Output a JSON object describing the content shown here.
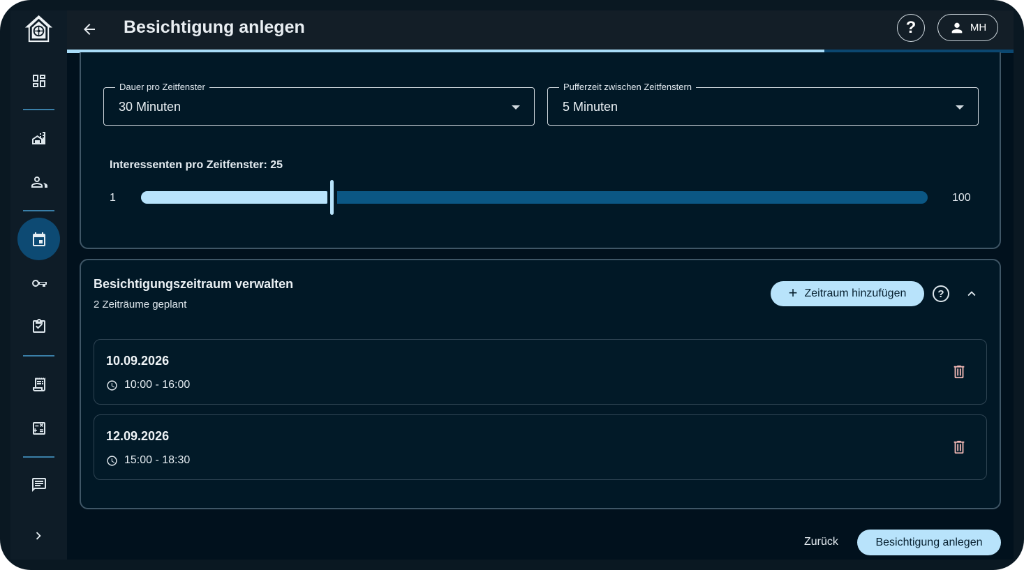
{
  "header": {
    "title": "Besichtigung anlegen",
    "help_label": "?",
    "user_initials": "MH",
    "progress_fraction": 0.8
  },
  "sidebar": {
    "items": [
      {
        "icon": "dashboard-icon"
      },
      {
        "icon": "building-icon"
      },
      {
        "icon": "people-icon"
      },
      {
        "icon": "calendar-icon",
        "active": true
      },
      {
        "icon": "key-icon"
      },
      {
        "icon": "checklist-icon"
      },
      {
        "icon": "receipt-icon"
      },
      {
        "icon": "calculator-icon"
      },
      {
        "icon": "message-icon"
      }
    ]
  },
  "settings": {
    "duration": {
      "label": "Dauer pro Zeitfenster",
      "value": "30 Minuten"
    },
    "buffer": {
      "label": "Pufferzeit zwischen Zeitfenstern",
      "value": "5 Minuten"
    },
    "slider": {
      "label": "Interessenten pro Zeitfenster: 25",
      "min": "1",
      "max": "100",
      "value": 25
    }
  },
  "periods": {
    "title": "Besichtigungszeitraum verwalten",
    "subtitle": "2 Zeiträume geplant",
    "add_label": "Zeitraum hinzufügen",
    "info_label": "?",
    "items": [
      {
        "date": "10.09.2026",
        "time": "10:00 - 16:00"
      },
      {
        "date": "12.09.2026",
        "time": "15:00 - 18:30"
      }
    ]
  },
  "footer": {
    "back_label": "Zurück",
    "submit_label": "Besichtigung anlegen"
  },
  "colors": {
    "accent": "#b8e3fb",
    "track": "#0b5784",
    "active_nav": "#0d4a73",
    "danger": "#f2b8b5"
  }
}
